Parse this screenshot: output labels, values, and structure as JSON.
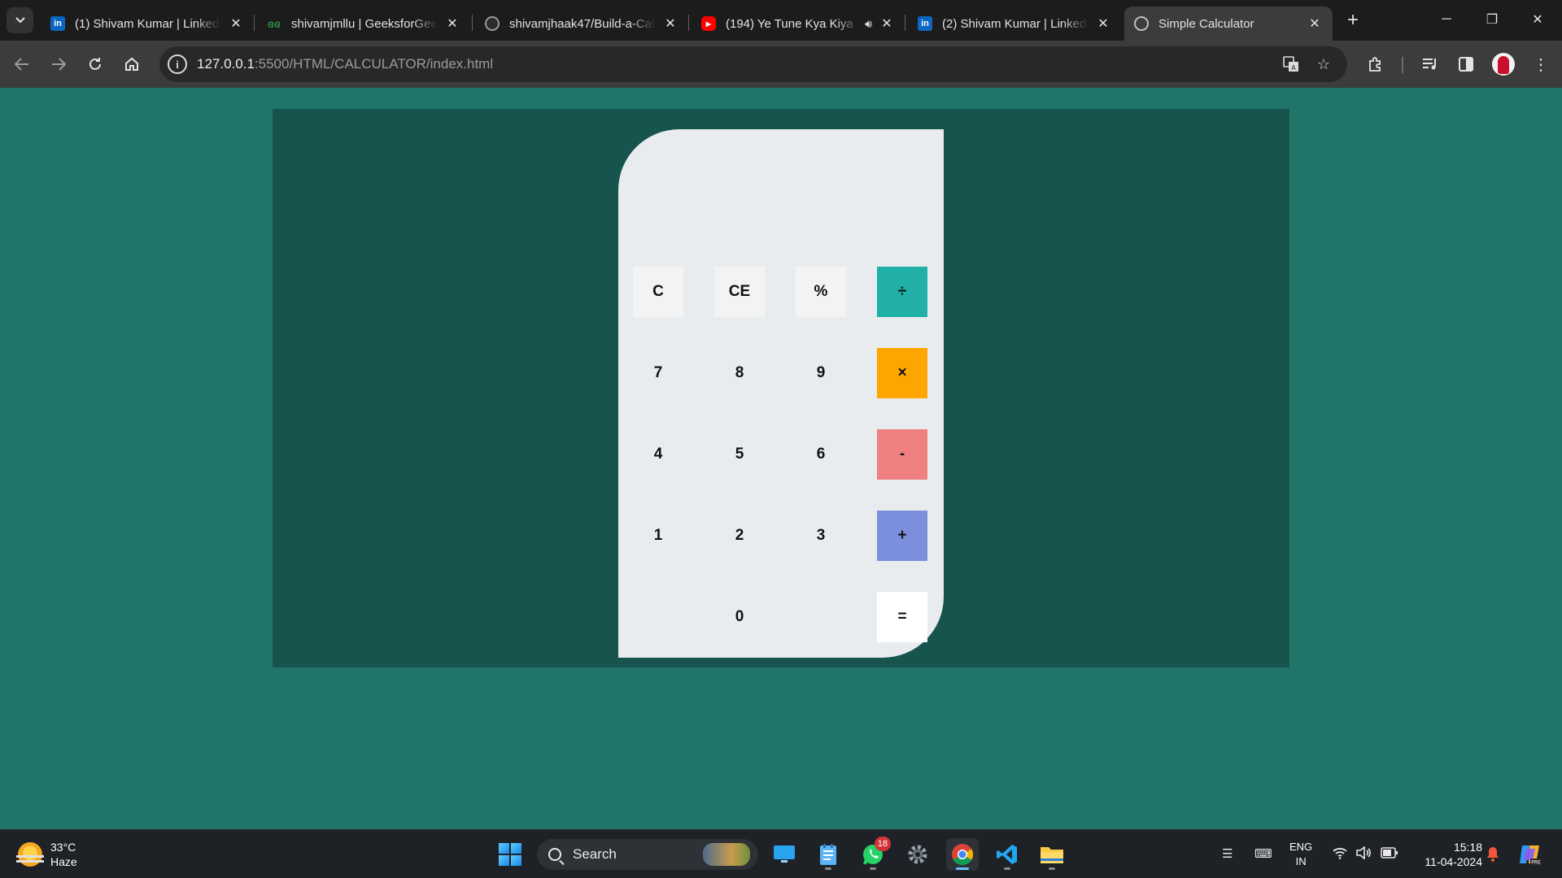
{
  "browser": {
    "tabs": [
      {
        "title": "(1) Shivam Kumar | LinkedIn",
        "favicon": "linkedin-icon"
      },
      {
        "title": "shivamjmllu | GeeksforGeeks",
        "favicon": "geeksforgeeks-icon"
      },
      {
        "title": "shivamjhaak47/Build-a-Calculator",
        "favicon": "github-icon"
      },
      {
        "title": "(194) Ye Tune Kya Kiya",
        "favicon": "youtube-icon"
      },
      {
        "title": "(2) Shivam Kumar | LinkedIn",
        "favicon": "linkedin-icon"
      },
      {
        "title": "Simple Calculator",
        "favicon": "globe-icon"
      }
    ],
    "url_host": "127.0.0.1",
    "url_rest": ":5500/HTML/CALCULATOR/index.html"
  },
  "calculator": {
    "display": "",
    "keys": {
      "clear": "C",
      "clear_entry": "CE",
      "percent": "%",
      "divide": "÷",
      "seven": "7",
      "eight": "8",
      "nine": "9",
      "multiply": "×",
      "four": "4",
      "five": "5",
      "six": "6",
      "subtract": "-",
      "one": "1",
      "two": "2",
      "three": "3",
      "add": "+",
      "zero": "0",
      "equals": "="
    }
  },
  "colors": {
    "page_background": "#1f7568",
    "stage_background": "#17544d",
    "calculator_body": "#e9ecef",
    "divide_key": "#20b0a8",
    "multiply_key": "#ffa500",
    "subtract_key": "#f08080",
    "add_key": "#7b8fdc",
    "equals_key": "#ffffff"
  },
  "taskbar": {
    "weather_temp": "33°C",
    "weather_desc": "Haze",
    "search_label": "Search",
    "whatsapp_badge": "18",
    "lang_line1": "ENG",
    "lang_line2": "IN",
    "time": "15:18",
    "date": "11-04-2024"
  }
}
